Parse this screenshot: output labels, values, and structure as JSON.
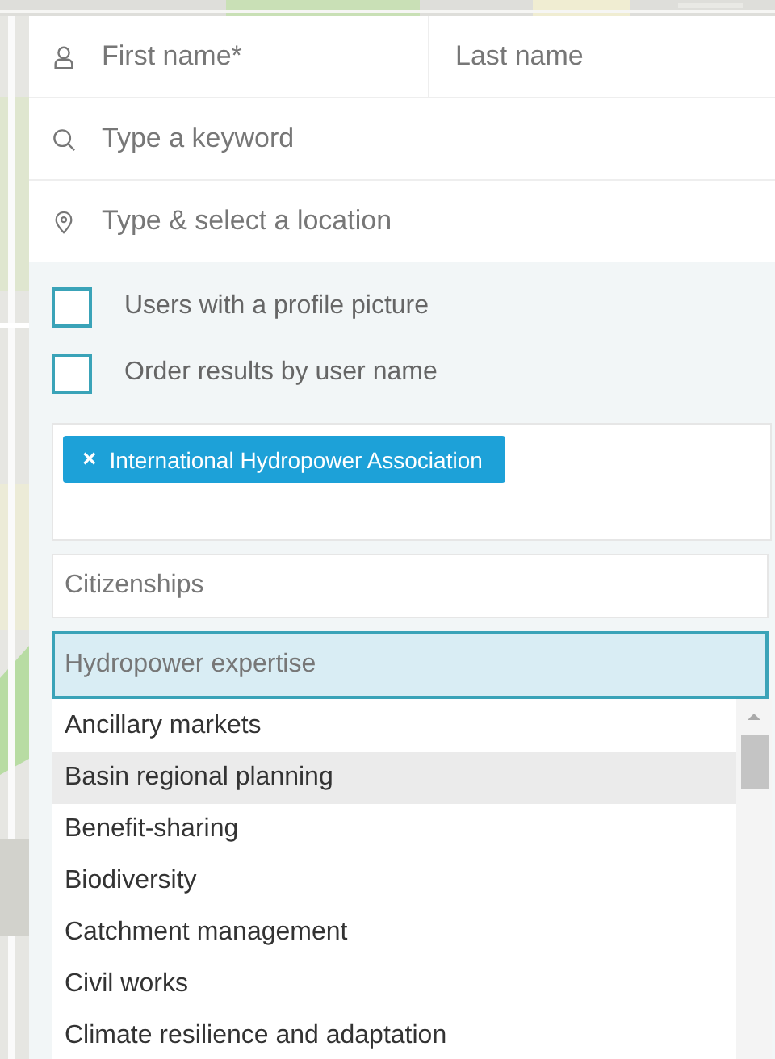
{
  "name_fields": {
    "first_name": {
      "placeholder": "First name*"
    },
    "last_name": {
      "placeholder": "Last name"
    }
  },
  "keyword_field": {
    "placeholder": "Type a keyword"
  },
  "location_field": {
    "placeholder": "Type & select a location"
  },
  "options": [
    {
      "label": "Users with a profile picture",
      "checked": false
    },
    {
      "label": "Order results by user name",
      "checked": false
    }
  ],
  "organizations": {
    "tags": [
      {
        "label": "International Hydropower Association",
        "remove": "×"
      }
    ]
  },
  "citizenships_field": {
    "placeholder": "Citizenships"
  },
  "expertise_field": {
    "placeholder": "Hydropower expertise"
  },
  "expertise_options": [
    {
      "label": "Ancillary markets",
      "selected": false
    },
    {
      "label": "Basin regional planning",
      "selected": true
    },
    {
      "label": "Benefit-sharing",
      "selected": false
    },
    {
      "label": "Biodiversity",
      "selected": false
    },
    {
      "label": "Catchment management",
      "selected": false
    },
    {
      "label": "Civil works",
      "selected": false
    },
    {
      "label": "Climate resilience and adaptation",
      "selected": false
    }
  ]
}
